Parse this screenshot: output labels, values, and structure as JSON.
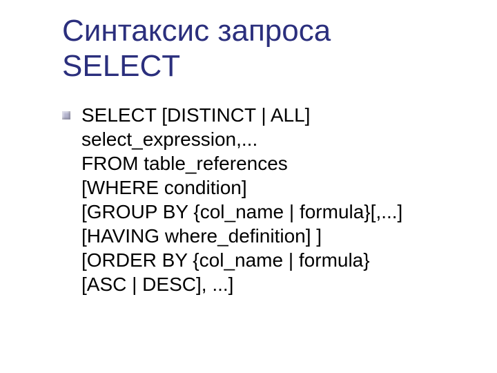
{
  "title_line1": "Синтаксис запроса",
  "title_line2": "SELECT",
  "body": {
    "l1": "SELECT [DISTINCT | ALL]",
    "l2": "select_expression,...",
    "l3": "FROM table_references",
    "l4": "[WHERE condition]",
    "l5": "[GROUP BY {col_name | formula}[,...]",
    "l6": "[HAVING where_definition] ]",
    "l7": "[ORDER BY {col_name | formula}",
    "l8": "[ASC | DESC], ...]"
  }
}
